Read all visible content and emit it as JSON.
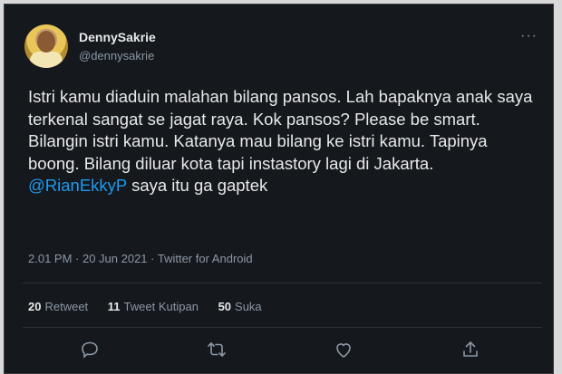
{
  "author": {
    "name": "DennySakrie",
    "handle": "@dennysakrie"
  },
  "tweet": {
    "text_before": "Istri kamu diaduin malahan bilang pansos. Lah bapaknya anak saya terkenal sangat se jagat raya. Kok pansos? Please be smart. Bilangin istri kamu. Katanya mau bilang ke istri kamu. Tapinya boong. Bilang diluar kota tapi instastory lagi di Jakarta. ",
    "mention": "@RianEkkyP",
    "text_after": " saya itu ga gaptek",
    "meta": "2.01 PM · 20 Jun 2021 · Twitter for Android"
  },
  "stats": {
    "retweet_count": "20",
    "retweet_label": "Retweet",
    "quote_count": "11",
    "quote_label": "Tweet Kutipan",
    "like_count": "50",
    "like_label": "Suka"
  },
  "icons": {
    "more": "more-icon",
    "reply": "reply-icon",
    "retweet": "retweet-icon",
    "like": "like-icon",
    "share": "share-icon"
  },
  "colors": {
    "background": "#15181c",
    "text": "#e7e9ea",
    "muted": "#8b98a5",
    "link": "#1d9bf0"
  }
}
